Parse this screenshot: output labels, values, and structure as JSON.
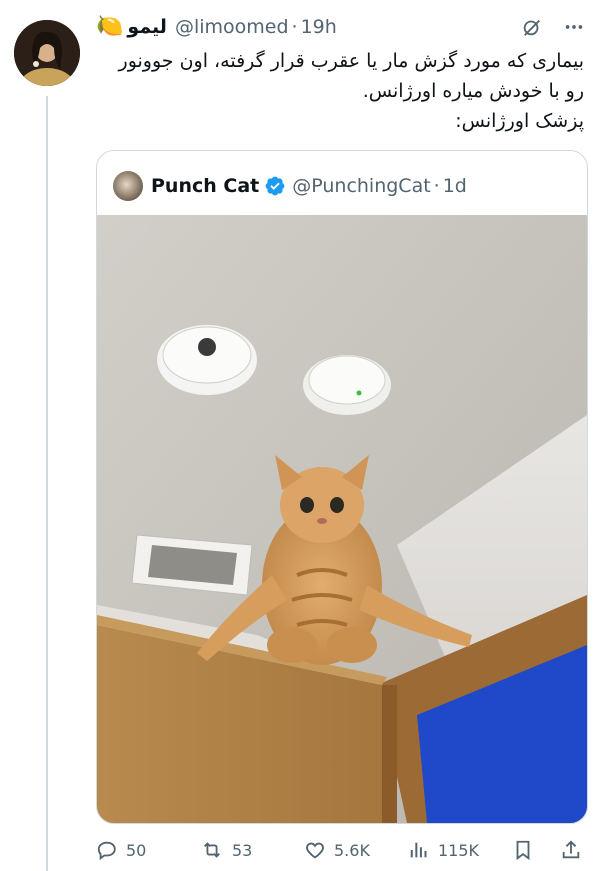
{
  "author": {
    "display_name": "لیمو",
    "emoji": "🍋",
    "handle": "@limoomed",
    "separator": "·",
    "time": "19h"
  },
  "tweet": {
    "lines": [
      "بیماری که مورد گزش مار یا عقرب قرار گرفته، اون جوونور",
      "رو با خودش میاره اورژانس.",
      "پزشک اورژانس:"
    ]
  },
  "quote": {
    "display_name": "Punch Cat",
    "handle": "@PunchingCat",
    "separator": "·",
    "time": "1d",
    "verified_color": "#1d9bf0",
    "image_description_icon": "cat-photo"
  },
  "actions": {
    "replies": "50",
    "retweets": "53",
    "likes": "5.6K",
    "views": "115K"
  },
  "colors": {
    "text": "#0f1419",
    "secondary": "#536471",
    "border": "#cfd9de",
    "accent": "#1d9bf0"
  }
}
